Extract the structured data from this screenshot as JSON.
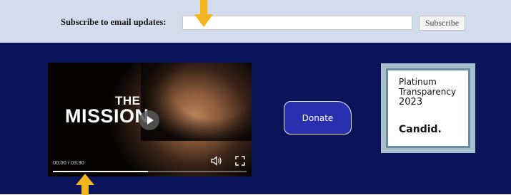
{
  "subscribe": {
    "label": "Subscribe to email updates:",
    "email_value": "",
    "button_label": "Subscribe"
  },
  "video": {
    "title_line1": "THE",
    "title_line2": "MISSION",
    "time": "00:00 / 03:30",
    "progress": 0.49
  },
  "donate": {
    "label": "Donate"
  },
  "badge": {
    "line1": "Platinum",
    "line2": "Transparency",
    "year": "2023",
    "brand": "Candid."
  },
  "annotations": {
    "arrow_color": "#f2b51b"
  },
  "icons": [
    "arrow-down-icon",
    "play-icon",
    "volume-icon",
    "fullscreen-icon",
    "arrow-up-icon"
  ]
}
